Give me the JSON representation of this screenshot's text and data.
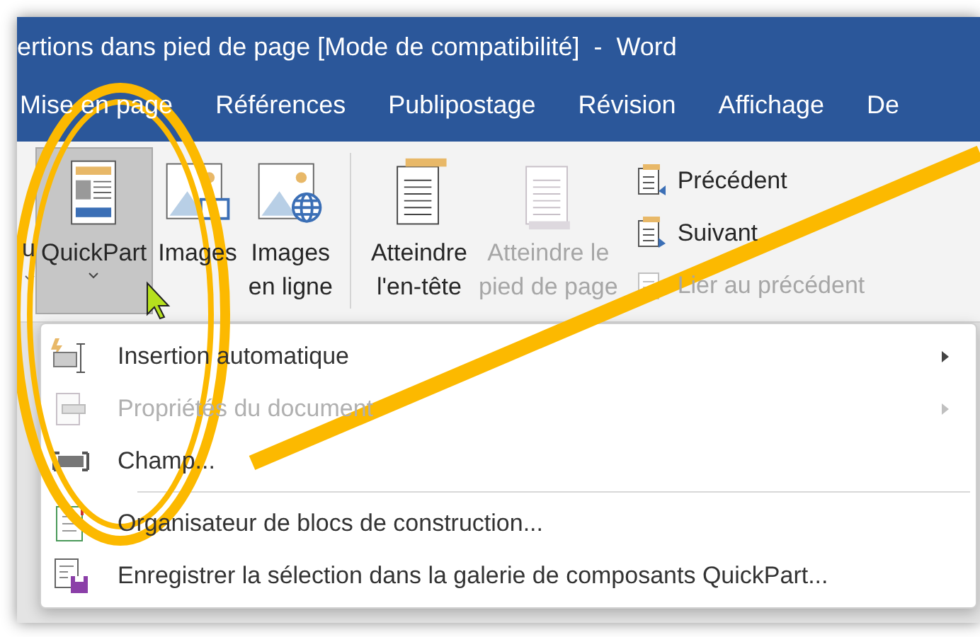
{
  "window": {
    "title": "ertions dans pied de page [Mode de compatibilité]  -  Word"
  },
  "tabs": [
    {
      "label": "Mise en page",
      "selected": false
    },
    {
      "label": "Références",
      "selected": false
    },
    {
      "label": "Publipostage",
      "selected": false
    },
    {
      "label": "Révision",
      "selected": false
    },
    {
      "label": "Affichage",
      "selected": false
    },
    {
      "label": "De",
      "selected": false
    }
  ],
  "ribbon": {
    "cut_group": {
      "label": "u"
    },
    "buttons": [
      {
        "label": "QuickPart",
        "kind": "quickpart",
        "selected": true,
        "disabled": false,
        "dropdown": true
      },
      {
        "label": "Images",
        "kind": "images",
        "selected": false,
        "disabled": false,
        "dropdown": false
      },
      {
        "label": "Images\nen ligne",
        "kind": "online",
        "selected": false,
        "disabled": false,
        "dropdown": false
      },
      {
        "label": "Atteindre\nl'en-tête",
        "kind": "header",
        "selected": false,
        "disabled": false,
        "dropdown": false
      },
      {
        "label": "Atteindre le\npied de page",
        "kind": "footer",
        "selected": false,
        "disabled": true,
        "dropdown": false
      }
    ],
    "nav": [
      {
        "label": "Précédent",
        "kind": "prev",
        "disabled": false
      },
      {
        "label": "Suivant",
        "kind": "next",
        "disabled": false
      },
      {
        "label": "Lier au précédent",
        "kind": "link",
        "disabled": true
      }
    ]
  },
  "menu": {
    "items": [
      {
        "label": "Insertion automatique",
        "kind": "autotext",
        "disabled": false,
        "submenu": true,
        "separator_before": false
      },
      {
        "label": "Propriétés du document",
        "kind": "property",
        "disabled": true,
        "submenu": true,
        "separator_before": false
      },
      {
        "label": "Champ...",
        "kind": "field",
        "disabled": false,
        "submenu": false,
        "separator_before": false
      },
      {
        "label": "Organisateur de blocs de construction...",
        "kind": "organizer",
        "disabled": false,
        "submenu": false,
        "separator_before": true
      },
      {
        "label": "Enregistrer la sélection dans la galerie de composants QuickPart...",
        "kind": "save",
        "disabled": false,
        "submenu": false,
        "separator_before": false
      }
    ]
  }
}
